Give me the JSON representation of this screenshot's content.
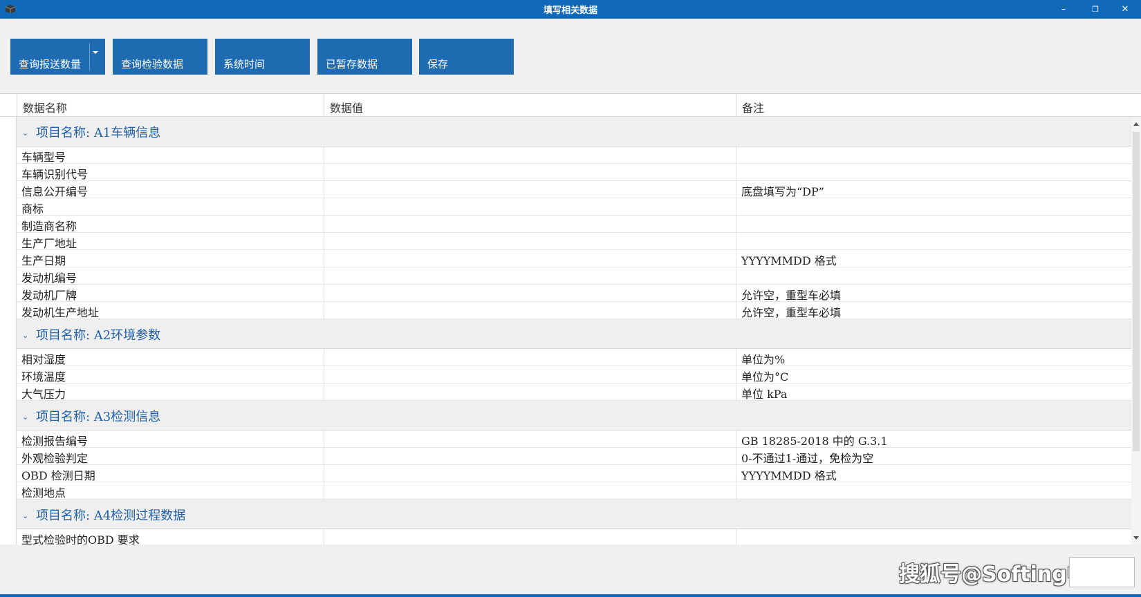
{
  "window": {
    "title": "填写相关数据",
    "minimize_icon": "–",
    "restore_icon": "❐",
    "close_icon": "✕"
  },
  "toolbar": {
    "buttons": [
      {
        "label": "查询报送数量",
        "has_dropdown": true
      },
      {
        "label": "查询检验数据"
      },
      {
        "label": "系统时间"
      },
      {
        "label": "已暂存数据"
      },
      {
        "label": "保存"
      }
    ],
    "accent_color": "#1e6bb1"
  },
  "grid": {
    "columns": [
      "数据名称",
      "数据值",
      "备注"
    ],
    "groups": [
      {
        "title": "项目名称: A1车辆信息",
        "rows": [
          {
            "name": "车辆型号",
            "value": "",
            "note": ""
          },
          {
            "name": "车辆识别代号",
            "value": "",
            "note": ""
          },
          {
            "name": "信息公开编号",
            "value": "",
            "note": "底盘填写为“DP”"
          },
          {
            "name": "商标",
            "value": "",
            "note": ""
          },
          {
            "name": "制造商名称",
            "value": "",
            "note": ""
          },
          {
            "name": "生产厂地址",
            "value": "",
            "note": ""
          },
          {
            "name": "生产日期",
            "value": "",
            "note": "YYYYMMDD 格式"
          },
          {
            "name": "发动机编号",
            "value": "",
            "note": ""
          },
          {
            "name": "发动机厂牌",
            "value": "",
            "note": "允许空，重型车必填"
          },
          {
            "name": "发动机生产地址",
            "value": "",
            "note": "允许空，重型车必填"
          }
        ]
      },
      {
        "title": "项目名称: A2环境参数",
        "rows": [
          {
            "name": "相对湿度",
            "value": "",
            "note": "单位为%"
          },
          {
            "name": "环境温度",
            "value": "",
            "note": "单位为°C"
          },
          {
            "name": "大气压力",
            "value": "",
            "note": "单位 kPa"
          }
        ]
      },
      {
        "title": "项目名称: A3检测信息",
        "rows": [
          {
            "name": "检测报告编号",
            "value": "",
            "note": "GB 18285-2018 中的 G.3.1"
          },
          {
            "name": "外观检验判定",
            "value": "",
            "note": "0-不通过1-通过，免检为空"
          },
          {
            "name": "OBD 检测日期",
            "value": "",
            "note": "YYYYMMDD 格式"
          },
          {
            "name": "检测地点",
            "value": "",
            "note": ""
          }
        ]
      },
      {
        "title": "项目名称: A4检测过程数据",
        "rows": [
          {
            "name": "型式检验时的OBD 要求",
            "value": "",
            "note": ""
          }
        ]
      }
    ]
  },
  "footer": {
    "watermark": "搜狐号@Softing中国"
  }
}
